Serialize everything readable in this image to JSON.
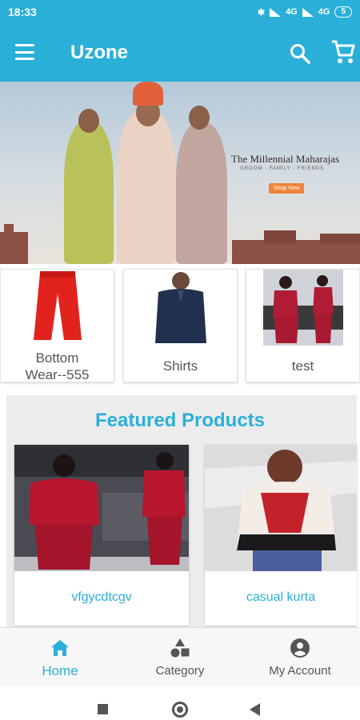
{
  "status_bar": {
    "time": "18:33",
    "network_1": "4G",
    "network_2": "4G",
    "battery": "5"
  },
  "app_bar": {
    "title": "Uzone",
    "icons": [
      "menu-icon",
      "search-icon",
      "cart-icon"
    ],
    "color": "#2ab0d8"
  },
  "banner": {
    "headline": "The Millennial Maharajas",
    "subline": "GROOM · FAMILY · FRIENDS",
    "cta": "Shop Now"
  },
  "categories": [
    {
      "label_line1": "Bottom",
      "label_line2": "Wear--555"
    },
    {
      "label": "Shirts"
    },
    {
      "label": "test"
    }
  ],
  "featured": {
    "title": "Featured Products",
    "products": [
      {
        "name": "vfgycdtcgv"
      },
      {
        "name": "casual kurta"
      }
    ]
  },
  "bottom_nav": {
    "items": [
      {
        "label": "Home",
        "icon": "home-icon",
        "active": true
      },
      {
        "label": "Category",
        "icon": "shapes-icon",
        "active": false
      },
      {
        "label": "My Account",
        "icon": "account-circle-icon",
        "active": false
      }
    ]
  }
}
